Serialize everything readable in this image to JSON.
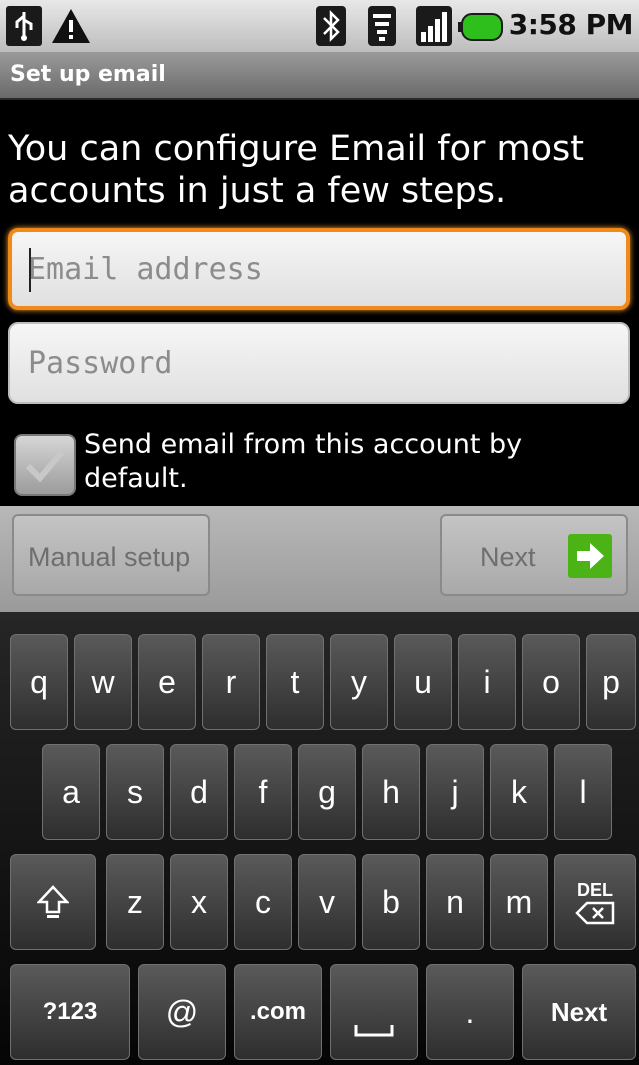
{
  "status_bar": {
    "time": "3:58 PM",
    "icons": [
      "usb-icon",
      "warning-icon",
      "bluetooth-icon",
      "wifi-icon",
      "signal-icon",
      "battery-icon"
    ],
    "battery_color": "#2fbf1d"
  },
  "title_bar": {
    "title": "Set up email"
  },
  "intro": "You can configure Email for most accounts in just a few steps.",
  "email_field": {
    "placeholder": "Email address",
    "value": ""
  },
  "password_field": {
    "placeholder": "Password",
    "value": ""
  },
  "default_checkbox": {
    "label": "Send email from this account by default.",
    "checked": false
  },
  "buttons": {
    "manual_setup": "Manual setup",
    "next": "Next",
    "next_icon": "arrow-right-icon"
  },
  "keyboard": {
    "row1": [
      "q",
      "w",
      "e",
      "r",
      "t",
      "y",
      "u",
      "i",
      "o",
      "p"
    ],
    "row2": [
      "a",
      "s",
      "d",
      "f",
      "g",
      "h",
      "j",
      "k",
      "l"
    ],
    "row3": [
      "z",
      "x",
      "c",
      "v",
      "b",
      "n",
      "m"
    ],
    "shift_icon": "shift-icon",
    "del_label": "DEL",
    "symbols_label": "?123",
    "at_label": "@",
    "dotcom_label": ".com",
    "space_icon": "space-icon",
    "period_label": ".",
    "next_label": "Next"
  },
  "colors": {
    "focus_orange": "#f28a1a",
    "next_arrow_green": "#4bb316"
  }
}
